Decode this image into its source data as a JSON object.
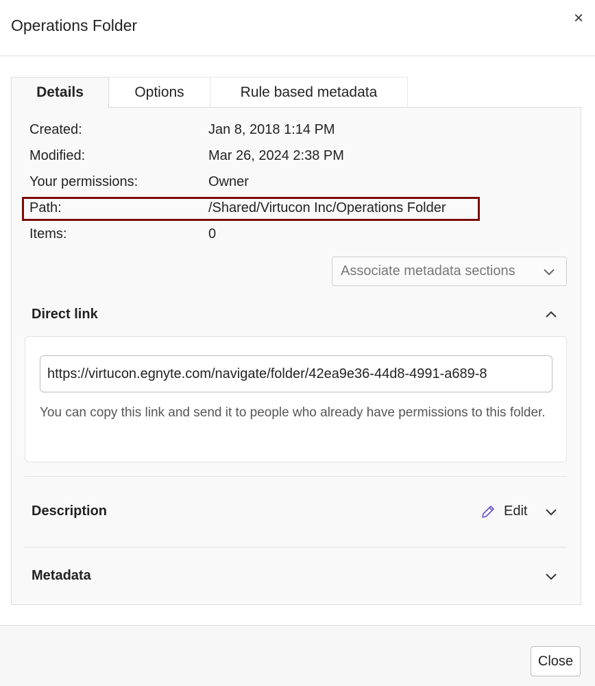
{
  "dialog": {
    "title": "Operations Folder",
    "close_icon": "close-icon"
  },
  "tabs": [
    {
      "label": "Details",
      "active": true
    },
    {
      "label": "Options",
      "active": false
    },
    {
      "label": "Rule based metadata",
      "active": false
    }
  ],
  "details": {
    "created_label": "Created:",
    "created_value": "Jan 8, 2018 1:14 PM",
    "modified_label": "Modified:",
    "modified_value": "Mar 26, 2024 2:38 PM",
    "permissions_label": "Your permissions:",
    "permissions_value": "Owner",
    "path_label": "Path:",
    "path_value": "/Shared/Virtucon Inc/Operations Folder",
    "items_label": "Items:",
    "items_value": "0"
  },
  "associate": {
    "label": "Associate metadata sections"
  },
  "direct_link": {
    "title": "Direct link",
    "url": "https://virtucon.egnyte.com/navigate/folder/42ea9e36-44d8-4991-a689-8",
    "help": "You can copy this link and send it to people who already have permissions to this folder."
  },
  "description": {
    "title": "Description",
    "edit_label": "Edit"
  },
  "metadata": {
    "title": "Metadata"
  },
  "footer": {
    "close_label": "Close"
  },
  "colors": {
    "highlight_border": "#7a0a0a",
    "edit_icon": "#6a4fc9"
  }
}
